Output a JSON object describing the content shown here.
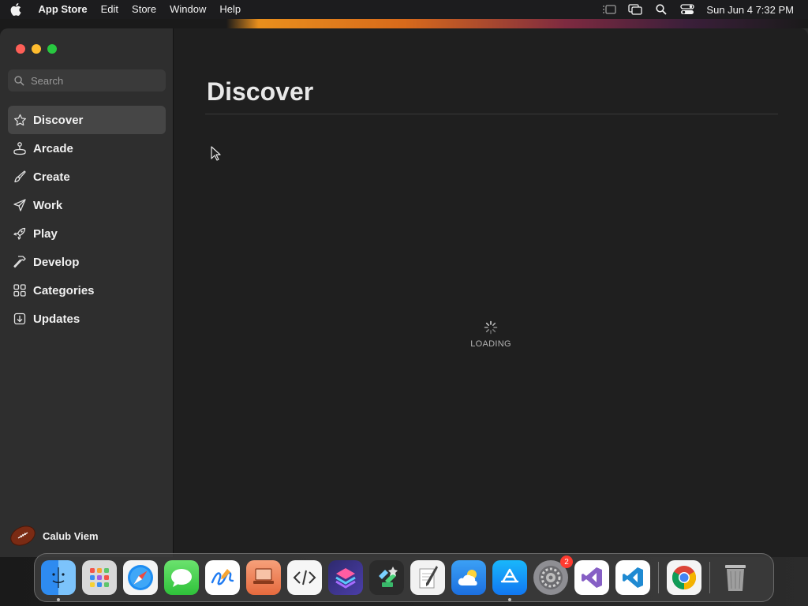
{
  "menubar": {
    "app_name": "App Store",
    "items": [
      "Edit",
      "Store",
      "Window",
      "Help"
    ],
    "clock": "Sun Jun 4  7:32 PM",
    "status_icons": [
      "stage-manager-icon",
      "screen-mirroring-icon",
      "spotlight-icon",
      "control-center-icon"
    ]
  },
  "sidebar": {
    "search": {
      "placeholder": "Search"
    },
    "items": [
      {
        "label": "Discover",
        "icon": "star-icon",
        "active": true
      },
      {
        "label": "Arcade",
        "icon": "joystick-icon"
      },
      {
        "label": "Create",
        "icon": "brush-icon"
      },
      {
        "label": "Work",
        "icon": "paper-plane-icon"
      },
      {
        "label": "Play",
        "icon": "rocket-icon"
      },
      {
        "label": "Develop",
        "icon": "hammer-icon"
      },
      {
        "label": "Categories",
        "icon": "grid-icon"
      },
      {
        "label": "Updates",
        "icon": "download-icon"
      }
    ],
    "user": {
      "name": "Calub Viem",
      "avatar": "football-avatar"
    }
  },
  "main": {
    "title": "Discover",
    "loading_text": "LOADING"
  },
  "dock": {
    "apps": [
      {
        "name": "Finder",
        "running": true
      },
      {
        "name": "Launchpad"
      },
      {
        "name": "Safari"
      },
      {
        "name": "Messages"
      },
      {
        "name": "Freeform"
      },
      {
        "name": "Keynote-like"
      },
      {
        "name": "Script Editor"
      },
      {
        "name": "Shortcuts"
      },
      {
        "name": "App Mover"
      },
      {
        "name": "Script Pen"
      },
      {
        "name": "Weather"
      },
      {
        "name": "App Store",
        "running": true
      },
      {
        "name": "System Settings",
        "badge": "2"
      },
      {
        "name": "Visual Studio"
      },
      {
        "name": "VS Code"
      },
      {
        "name": "Chrome"
      },
      {
        "name": "Trash"
      }
    ]
  },
  "colors": {
    "accent_active": "#464646",
    "close": "#fe5f57",
    "minimize": "#febc2e",
    "zoom": "#28c840",
    "badge": "#ff3b30"
  }
}
